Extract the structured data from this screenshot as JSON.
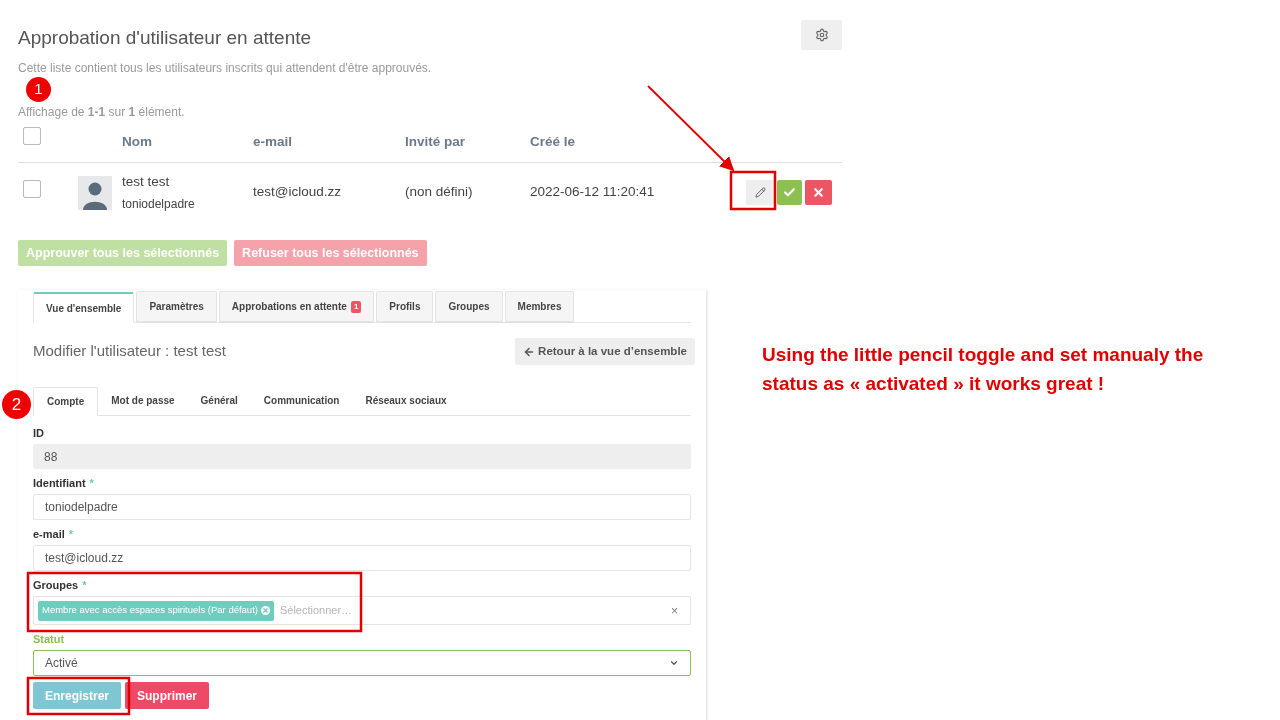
{
  "page": {
    "title": "Approbation d'utilisateur en attente",
    "description": "Cette liste contient tous les utilisateurs inscrits qui attendent d'être approuvés.",
    "summary": "Affichage de **1-1** sur **1** élément.",
    "table": {
      "select_all_checked": false,
      "columns": [
        "Nom",
        "e-mail",
        "Invité par",
        "Créé le"
      ],
      "rows": [
        {
          "checked": false,
          "name": "test test",
          "username": "toniodelpadre",
          "email": "test@icloud.zz",
          "invited_by": "(non défini)",
          "created": "2022-06-12 11:20:41"
        }
      ]
    },
    "bulk_buttons": [
      {
        "label": "Approuver tous les sélectionnés",
        "kind": "approve"
      },
      {
        "label": "Refuser tous les sélectionnés",
        "kind": "reject"
      }
    ]
  },
  "editor": {
    "tabs": [
      {
        "label": "Vue d'ensemble",
        "selected": true
      },
      {
        "label": "Paramètres",
        "selected": false
      },
      {
        "label": "Approbations en attente",
        "badge": "1",
        "selected": false
      },
      {
        "label": "Profils",
        "selected": false
      },
      {
        "label": "Groupes",
        "selected": false
      },
      {
        "label": "Membres",
        "selected": false
      }
    ],
    "title": "Modifier l'utilisateur : test test",
    "required_mark": "*",
    "back_button": "Retour à la vue d’ensemble",
    "subtabs": [
      {
        "label": "Compte",
        "selected": true
      },
      {
        "label": "Mot de passe",
        "selected": false
      },
      {
        "label": "Général",
        "selected": false
      },
      {
        "label": "Communication",
        "selected": false
      },
      {
        "label": "Réseaux sociaux",
        "selected": false
      }
    ],
    "fields": [
      {
        "kind": "readonly",
        "label": "ID",
        "required": false,
        "value": "88"
      },
      {
        "kind": "text",
        "label": "Identifiant",
        "required": true,
        "value": "toniodelpadre"
      },
      {
        "kind": "text",
        "label": "e-mail",
        "required": true,
        "value": "test@icloud.zz"
      },
      {
        "kind": "tags",
        "label": "Groupes",
        "required": true,
        "tags": [
          "Membre avec accès espaces spirituels (Par défaut)"
        ],
        "placeholder": "Sélectionner…",
        "clear": "×"
      },
      {
        "kind": "select",
        "label": "Statut",
        "required": false,
        "valid": true,
        "value": "Activé"
      }
    ],
    "buttons": [
      {
        "label": "Enregistrer",
        "kind": "save"
      },
      {
        "label": "Supprimer",
        "kind": "delete"
      }
    ]
  },
  "annotations": {
    "markers": [
      "1",
      "2"
    ],
    "note": "Using the little pencil toggle and set manualy the status as « activated » it works great !"
  }
}
